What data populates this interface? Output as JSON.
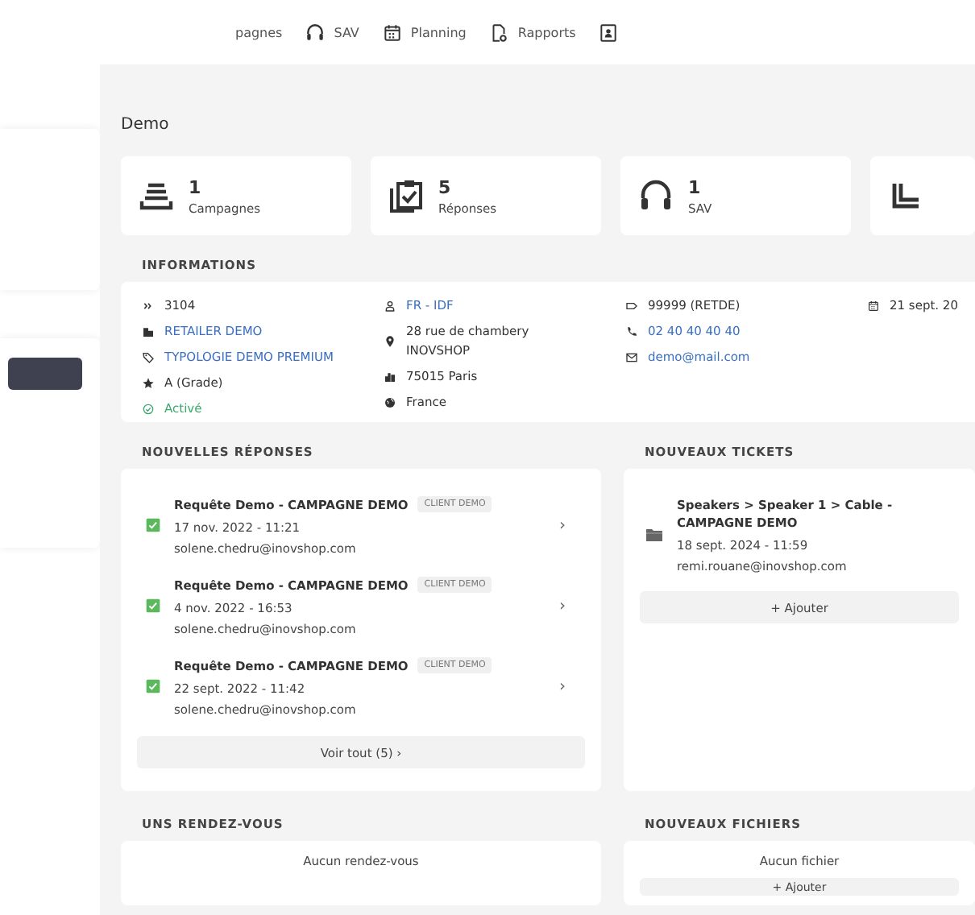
{
  "nav": [
    {
      "label": "pagnes"
    },
    {
      "label": "SAV"
    },
    {
      "label": "Planning"
    },
    {
      "label": "Rapports"
    }
  ],
  "page_title": "Demo",
  "stats": [
    {
      "value": "1",
      "label": "Campagnes"
    },
    {
      "value": "5",
      "label": "Réponses"
    },
    {
      "value": "1",
      "label": "SAV"
    }
  ],
  "informations": {
    "title": "INFORMATIONS",
    "columns": [
      [
        {
          "text": "3104",
          "kind": "plain"
        },
        {
          "text": "RETAILER DEMO",
          "kind": "link"
        },
        {
          "text": "TYPOLOGIE DEMO PREMIUM",
          "kind": "link"
        },
        {
          "text": "A (Grade)",
          "kind": "plain"
        },
        {
          "text": "Activé",
          "kind": "success"
        }
      ],
      [
        {
          "text": "FR - IDF",
          "kind": "link"
        },
        {
          "text": "28 rue de chambery INOVSHOP",
          "kind": "plain"
        },
        {
          "text": "75015 Paris",
          "kind": "plain"
        },
        {
          "text": "France",
          "kind": "plain"
        }
      ],
      [
        {
          "text": "99999 (RETDE)",
          "kind": "plain"
        },
        {
          "text": "02 40 40 40 40",
          "kind": "link"
        },
        {
          "text": "demo@mail.com",
          "kind": "link"
        }
      ],
      [
        {
          "text": "21 sept. 20",
          "kind": "plain"
        }
      ]
    ]
  },
  "responses": {
    "title": "NOUVELLES RÉPONSES",
    "items": [
      {
        "title": "Requête Demo - CAMPAGNE DEMO",
        "tag": "CLIENT DEMO",
        "date": "17 nov. 2022 - 11:21",
        "email": "solene.chedru@inovshop.com",
        "checked": true,
        "chevron": "›"
      },
      {
        "title": "Requête Demo - CAMPAGNE DEMO",
        "tag": "CLIENT DEMO",
        "date": "4 nov. 2022 - 16:53",
        "email": "solene.chedru@inovshop.com",
        "checked": true,
        "chevron": "›"
      },
      {
        "title": "Requête Demo - CAMPAGNE DEMO",
        "tag": "CLIENT DEMO",
        "date": "22 sept. 2022 - 11:42",
        "email": "solene.chedru@inovshop.com",
        "checked": true,
        "chevron": "›"
      }
    ],
    "see_all": "Voir tout (5) ›"
  },
  "tickets": {
    "title": "NOUVEAUX TICKETS",
    "items": [
      {
        "title": "Speakers > Speaker 1 > Cable - CAMPAGNE DEMO",
        "date": "18 sept. 2024 - 11:59",
        "email": "remi.rouane@inovshop.com"
      }
    ],
    "add_label": "+ Ajouter"
  },
  "appointments": {
    "title": "UNS RENDEZ-VOUS",
    "empty": "Aucun rendez-vous"
  },
  "files": {
    "title": "NOUVEAUX FICHIERS",
    "empty": "Aucun fichier",
    "add_label": "+ Ajouter"
  }
}
